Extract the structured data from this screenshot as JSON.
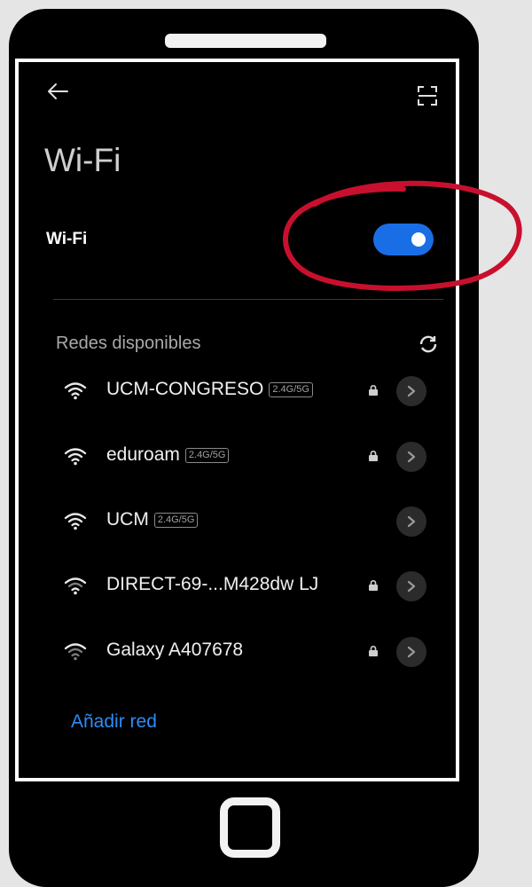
{
  "title": "Wi-Fi",
  "wifi_toggle": {
    "label": "Wi-Fi",
    "enabled": true
  },
  "section_title": "Redes disponibles",
  "networks": [
    {
      "name": "UCM-CONGRESO",
      "band": "2.4G/5G",
      "locked": true,
      "signal": "strong"
    },
    {
      "name": "eduroam",
      "band": "2.4G/5G",
      "locked": true,
      "signal": "strong"
    },
    {
      "name": "UCM",
      "band": "2.4G/5G",
      "locked": false,
      "signal": "strong"
    },
    {
      "name": "DIRECT-69-...M428dw LJ",
      "band": "",
      "locked": true,
      "signal": "weak"
    },
    {
      "name": "Galaxy A407678",
      "band": "",
      "locked": true,
      "signal": "weaker"
    }
  ],
  "add_network_label": "Añadir red",
  "icons": {
    "back": "back-arrow-icon",
    "scan": "scan-icon",
    "refresh": "refresh-icon",
    "wifi": "wifi-icon",
    "lock": "lock-icon",
    "chevron": "chevron-right-icon"
  },
  "colors": {
    "accent": "#1a6ee5",
    "link": "#2f8cf4",
    "highlight": "#c8102e",
    "background": "#000000"
  }
}
